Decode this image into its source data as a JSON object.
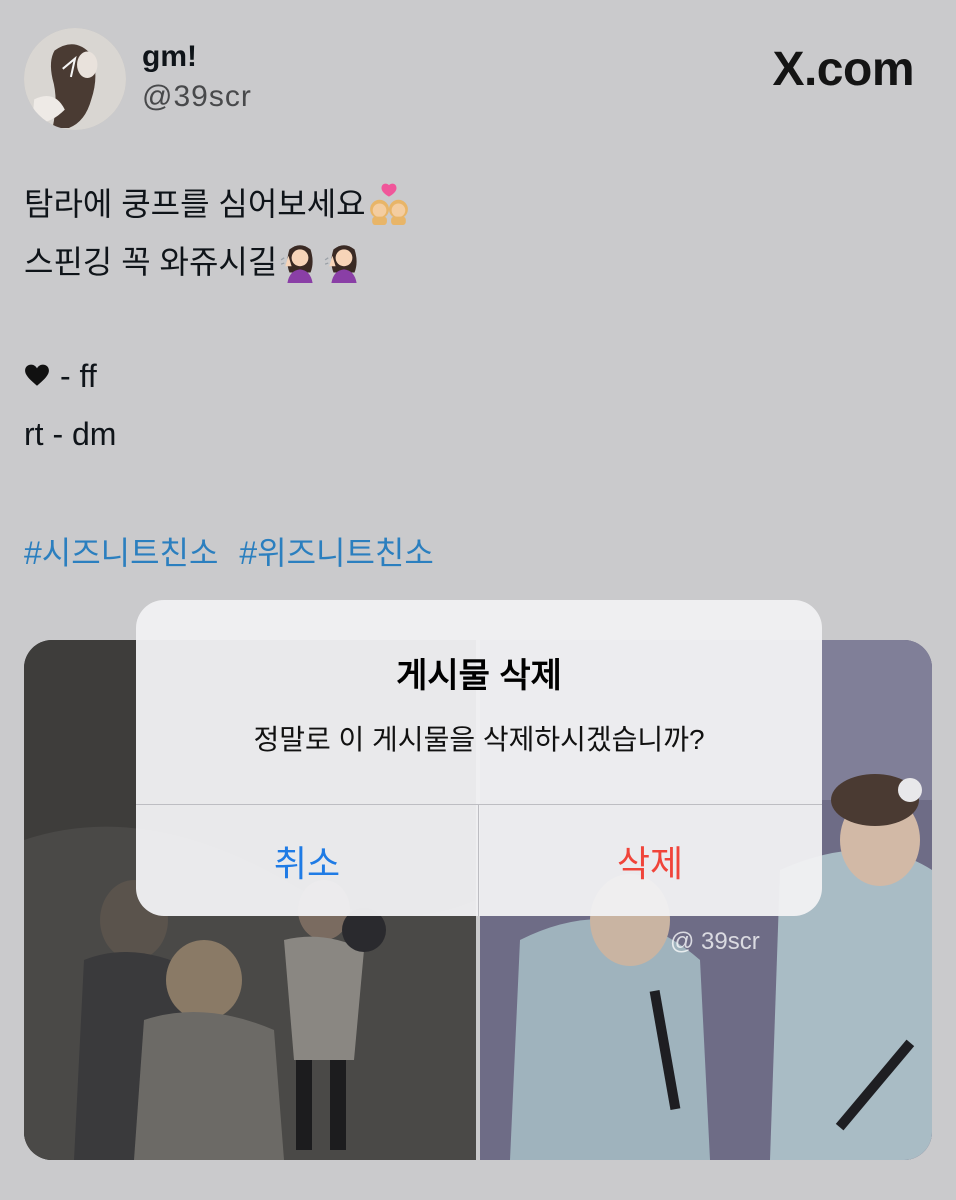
{
  "profile": {
    "display_name": "gm!",
    "handle": "@39scr"
  },
  "site": {
    "logo_text": "X.com"
  },
  "tweet": {
    "line1": "탐라에 쿵프를 심어보세요",
    "line2": "스핀깅 꼭 와쥬시길",
    "line3": " - ff",
    "line4": "rt - dm",
    "hashtags": [
      "#시즈니트친소",
      "#위즈니트친소"
    ]
  },
  "media": {
    "watermark": "@ 39scr"
  },
  "alert": {
    "title": "게시물 삭제",
    "message": "정말로 이 게시물을 삭제하시겠습니까?",
    "cancel_label": "취소",
    "delete_label": "삭제"
  },
  "colors": {
    "background": "#cacacc",
    "hashtag": "#2b7fbf",
    "cancel": "#1f7be5",
    "delete": "#f0443a"
  },
  "icons": [
    "avatar-image",
    "kissing-women-emoji",
    "tipping-hand-emoji",
    "black-heart-icon"
  ]
}
